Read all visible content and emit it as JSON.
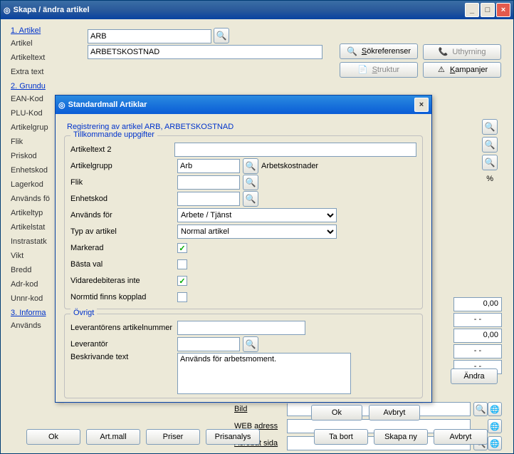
{
  "window": {
    "title": "Skapa / ändra artikel",
    "minimize": "_",
    "maximize": "□",
    "close": "×"
  },
  "sections": {
    "s1": "1. Artikel",
    "s2": "2. Grundu",
    "s3": "3. Informa"
  },
  "labels": {
    "artikel": "Artikel",
    "artikeltext": "Artikeltext",
    "extratext": "Extra text",
    "eankod": "EAN-Kod",
    "plukod": "PLU-Kod",
    "artikelgrup": "Artikelgrup",
    "flik": "Flik",
    "priskod": "Priskod",
    "enhetskod": "Enhetskod",
    "lagerkod": "Lagerkod",
    "anvandsfor_partial": "Används fö",
    "artikeltyp": "Artikeltyp",
    "artikelstat": "Artikelstat",
    "instrastatk": "Instrastatk",
    "vikt": "Vikt",
    "bredd": "Bredd",
    "adrkod": "Adr-kod",
    "unnrkod": "Unnr-kod",
    "anvands": "Används"
  },
  "fields": {
    "artikel": "ARB",
    "artikeltext": "ARBETSKOSTNAD"
  },
  "topright": {
    "sokref": "Sökreferenser",
    "uthyrning": "Uthyrning",
    "struktur": "Struktur",
    "kampanjer": "Kampanjer"
  },
  "bottom_nums": {
    "n1": "0,00",
    "n2": "- -",
    "n3": "0,00",
    "n4": "- -",
    "n5": "- -"
  },
  "bottomfields": {
    "bild": "Bild",
    "web": "WEB adress",
    "acrobat": "Acrobat sida"
  },
  "buttons": {
    "andra": "Ändra",
    "ok": "Ok",
    "artmall": "Art.mall",
    "priser": "Priser",
    "prisanalys": "Prisanalys",
    "tabort": "Ta bort",
    "skapany": "Skapa ny",
    "avbryt": "Avbryt"
  },
  "pct": "%",
  "modal": {
    "title": "Standardmall Artiklar",
    "close": "×",
    "heading": "Registrering av artikel ARB, ARBETSKOSTNAD",
    "legend1": "Tillkommande uppgifter",
    "legend2": "Övrigt",
    "labels": {
      "artikeltext2": "Artikeltext 2",
      "artikelgrupp": "Artikelgrupp",
      "flik": "Flik",
      "enhetskod": "Enhetskod",
      "anvandsfor": "Används för",
      "typavartikel": "Typ av artikel",
      "markerad": "Markerad",
      "bastaval": "Bästa val",
      "vidaredeb": "Vidaredebiteras inte",
      "normtid": "Normtid finns kopplad",
      "levartnr": "Leverantörens artikelnummer",
      "leverantor": "Leverantör",
      "beskrivande": "Beskrivande text"
    },
    "values": {
      "artikelgrupp": "Arb",
      "artikelgrupp_display": "Arbetskostnader",
      "anvandsfor": "Arbete / Tjänst",
      "typavartikel": "Normal artikel",
      "markerad": true,
      "bastaval": false,
      "vidaredeb": true,
      "normtid": false,
      "beskrivande": "Används för arbetsmoment."
    },
    "buttons": {
      "ok": "Ok",
      "avbryt": "Avbryt"
    }
  }
}
